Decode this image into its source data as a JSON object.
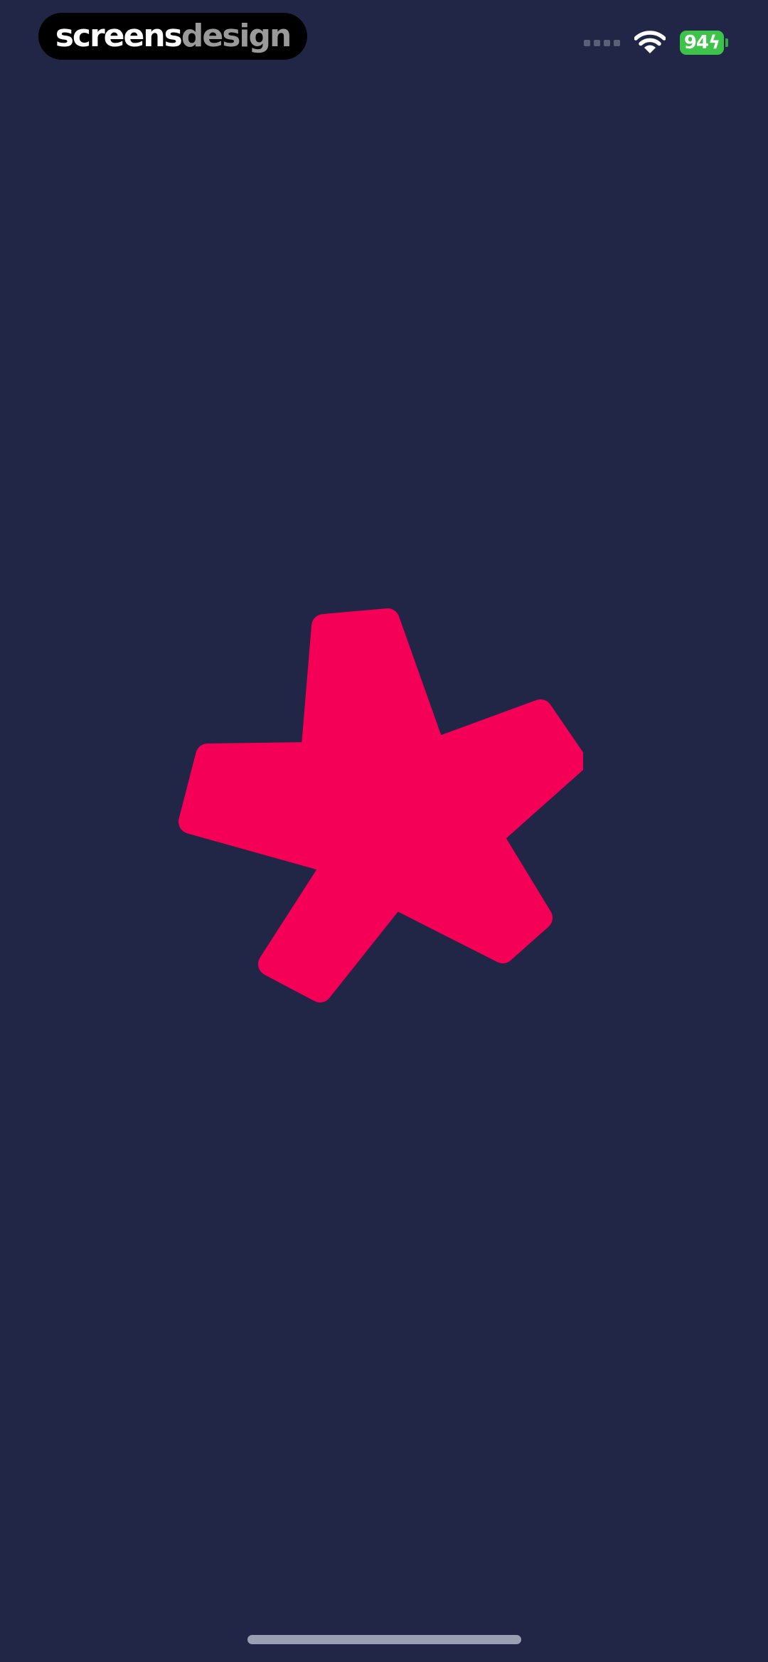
{
  "watermark": {
    "part_a": "screens",
    "part_b": "design"
  },
  "status_bar": {
    "battery_level": "94",
    "charging_glyph": "ϟ",
    "icons": [
      "signal-icon",
      "wifi-icon",
      "battery-charging-icon"
    ]
  },
  "splash": {
    "logo_icon": "asterisk-star-logo-icon"
  },
  "colors": {
    "background": "#212546",
    "logo": "#F50057",
    "battery": "#3EC34A",
    "home_indicator": "#9C9EB1"
  }
}
